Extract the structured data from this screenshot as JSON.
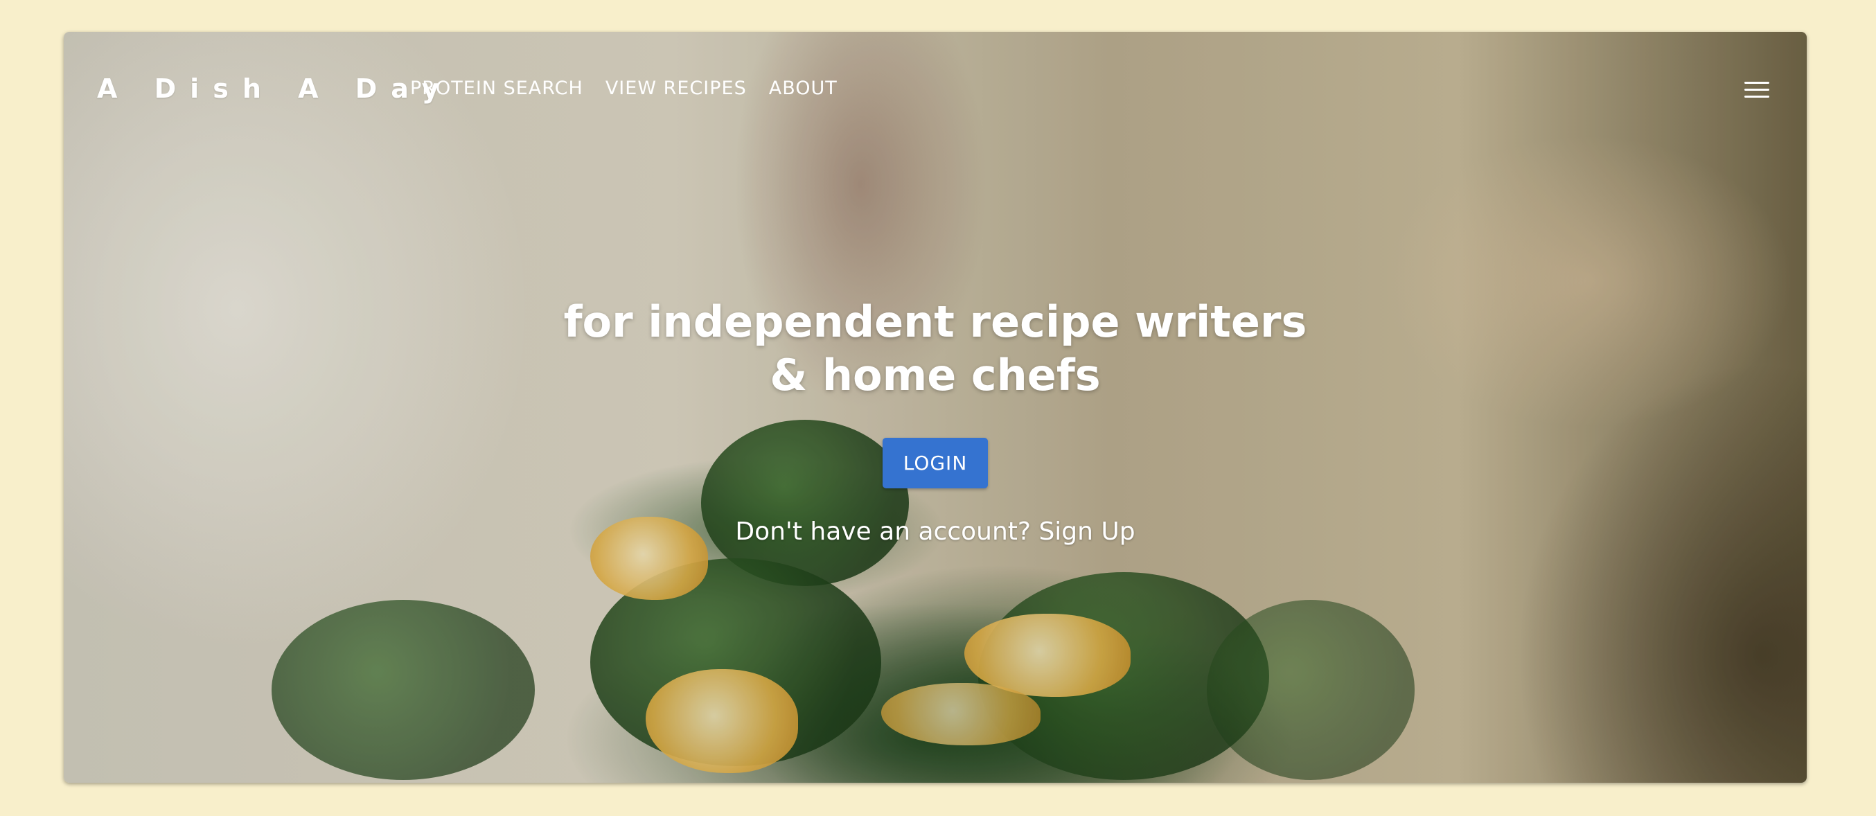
{
  "brand": {
    "name": "A Dish A Day"
  },
  "nav": {
    "links": [
      {
        "label": "PROTEIN SEARCH"
      },
      {
        "label": "VIEW RECIPES"
      },
      {
        "label": "ABOUT"
      }
    ],
    "menu_icon": "hamburger-menu-icon"
  },
  "hero": {
    "headline_line1": "for independent recipe writers",
    "headline_line2": "& home chefs",
    "login_label": "LOGIN",
    "signup_prompt": "Don't have an account? ",
    "signup_link": "Sign Up"
  },
  "colors": {
    "page_background": "#f8efcb",
    "button": "#3573d0",
    "text": "#ffffff"
  }
}
